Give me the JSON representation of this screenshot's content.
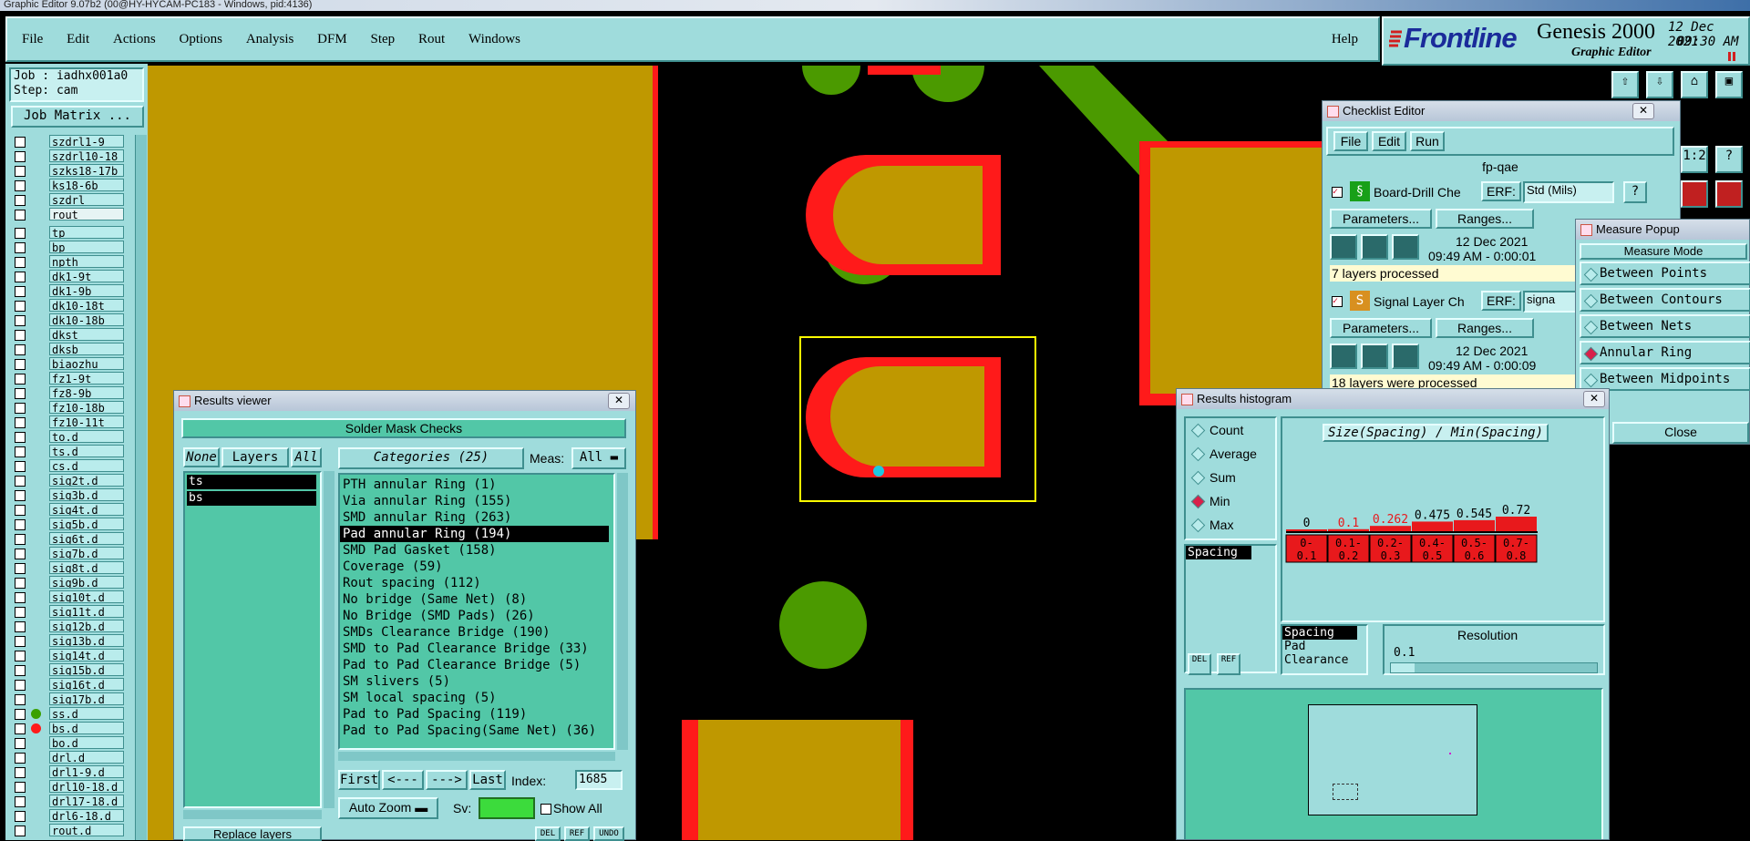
{
  "window_title": "Graphic Editor 9.07b2 (00@HY-HYCAM-PC183 - Windows, pid:4136)",
  "menu": [
    "File",
    "Edit",
    "Actions",
    "Options",
    "Analysis",
    "DFM",
    "Step",
    "Rout",
    "Windows"
  ],
  "help_label": "Help",
  "brand": {
    "logo": "Frontline",
    "product": "Genesis 2000",
    "subtitle": "Graphic Editor",
    "date": "12 Dec 2021",
    "time": "09:30 AM"
  },
  "job": {
    "job_label": "Job : iadhx001a0",
    "step_label": "Step: cam",
    "matrix_button": "Job Matrix ..."
  },
  "layers_top": [
    "szdrl1-9",
    "szdrl10-18",
    "szks18-17b",
    "ks18-6b",
    "szdrl",
    "rout"
  ],
  "layers": [
    "tp",
    "bp",
    "npth",
    "dk1-9t",
    "dk1-9b",
    "dk10-18t",
    "dk10-18b",
    "dkst",
    "dksb",
    "biaozhu",
    "fz1-9t",
    "fz8-9b",
    "fz10-18b",
    "fz10-11t",
    "to.d",
    "ts.d",
    "cs.d",
    "sig2t.d",
    "sig3b.d",
    "sig4t.d",
    "sig5b.d",
    "sig6t.d",
    "sig7b.d",
    "sig8t.d",
    "sig9b.d",
    "sig10t.d",
    "sig11t.d",
    "sig12b.d",
    "sig13b.d",
    "sig14t.d",
    "sig15b.d",
    "sig16t.d",
    "sig17b.d",
    "ss.d",
    "bs.d",
    "bo.d",
    "drl.d",
    "drl1-9.d",
    "drl10-18.d",
    "drl17-18.d",
    "drl6-18.d",
    "rout.d"
  ],
  "results_viewer": {
    "title": "Results viewer",
    "header": "Solder Mask Checks",
    "none": "None",
    "layers": "Layers",
    "all": "All",
    "categories_label": "Categories (25)",
    "meas_label": "Meas:",
    "meas_value": "All",
    "layer_list": [
      "ts",
      "bs"
    ],
    "categories": [
      "PTH annular Ring (1)",
      "Via annular Ring (155)",
      "SMD annular Ring (263)",
      "Pad annular Ring (194)",
      "SMD Pad Gasket (158)",
      "Coverage (59)",
      "Rout spacing (112)",
      "No bridge (Same Net) (8)",
      "No Bridge (SMD Pads) (26)",
      "SMDs Clearance Bridge (190)",
      "SMD to Pad Clearance Bridge (33)",
      "Pad to Pad Clearance Bridge (5)",
      "SM slivers (5)",
      "SM local spacing (5)",
      "Pad to Pad Spacing (119)",
      "Pad to Pad Spacing(Same Net) (36)"
    ],
    "nav": {
      "first": "First",
      "prev": "<---",
      "next": "--->",
      "last": "Last",
      "index_label": "Index:",
      "index_value": "1685"
    },
    "zoom": "Auto Zoom",
    "sv": "Sv:",
    "show_all": "Show All",
    "replace_layers": "Replace layers",
    "del": "DEL",
    "ref": "REF",
    "undo": "UNDO"
  },
  "checklist": {
    "title": "Checklist Editor",
    "menu": [
      "File",
      "Edit",
      "Run"
    ],
    "name": "fp-qae",
    "items": [
      {
        "name": "Board-Drill Che",
        "erf": "ERF:",
        "erf_value": "Std (Mils)",
        "params": "Parameters...",
        "ranges": "Ranges...",
        "date": "12 Dec 2021",
        "time": "09:49 AM - 0:00:01",
        "status": "7 layers processed"
      },
      {
        "name": "Signal Layer Ch",
        "erf": "ERF:",
        "erf_value": "signa",
        "params": "Parameters...",
        "ranges": "Ranges...",
        "date": "12 Dec 2021",
        "time": "09:49 AM - 0:00:09",
        "status": "18 layers were processed"
      }
    ]
  },
  "measure": {
    "title": "Measure Popup",
    "header": "Measure Mode",
    "modes": [
      "Between Points",
      "Between Contours",
      "Between Nets",
      "Annular Ring",
      "Between Midpoints"
    ],
    "selected": "Annular Ring",
    "close": "Close"
  },
  "histogram": {
    "title": "Results histogram",
    "options": [
      "Count",
      "Average",
      "Sum",
      "Min",
      "Max"
    ],
    "selected": "Min",
    "chart_title": "Size(Spacing) / Min(Spacing)",
    "list1": [
      "Spacing"
    ],
    "list2": [
      "Spacing",
      "Pad",
      "Clearance"
    ],
    "resolution_label": "Resolution",
    "resolution_value": "0.1",
    "del": "DEL",
    "ref": "REF"
  },
  "chart_data": {
    "type": "bar",
    "title": "Size(Spacing) / Min(Spacing)",
    "categories": [
      "0-\n0.1",
      "0.1-\n0.2",
      "0.2-\n0.3",
      "0.4-\n0.5",
      "0.5-\n0.6",
      "0.7-\n0.8"
    ],
    "category_labels": [
      "0- 0.1",
      "0.1- 0.2",
      "0.2- 0.3",
      "0.4- 0.5",
      "0.5- 0.6",
      "0.7- 0.8"
    ],
    "values": [
      0,
      0.1,
      0.262,
      0.475,
      0.545,
      0.72
    ],
    "value_labels": [
      "0",
      "0.1",
      "0.262",
      "0.475",
      "0.545",
      "0.72"
    ],
    "red_labels": [
      false,
      true,
      true,
      false,
      false,
      false
    ],
    "ylim": [
      0,
      0.72
    ],
    "bar_color": "#e8191c"
  },
  "colors": {
    "accent": "#9fdcdc",
    "copper": "#bf9800",
    "green": "#4b9a00",
    "red": "#ff1a1a",
    "yellow": "#ffff00"
  }
}
